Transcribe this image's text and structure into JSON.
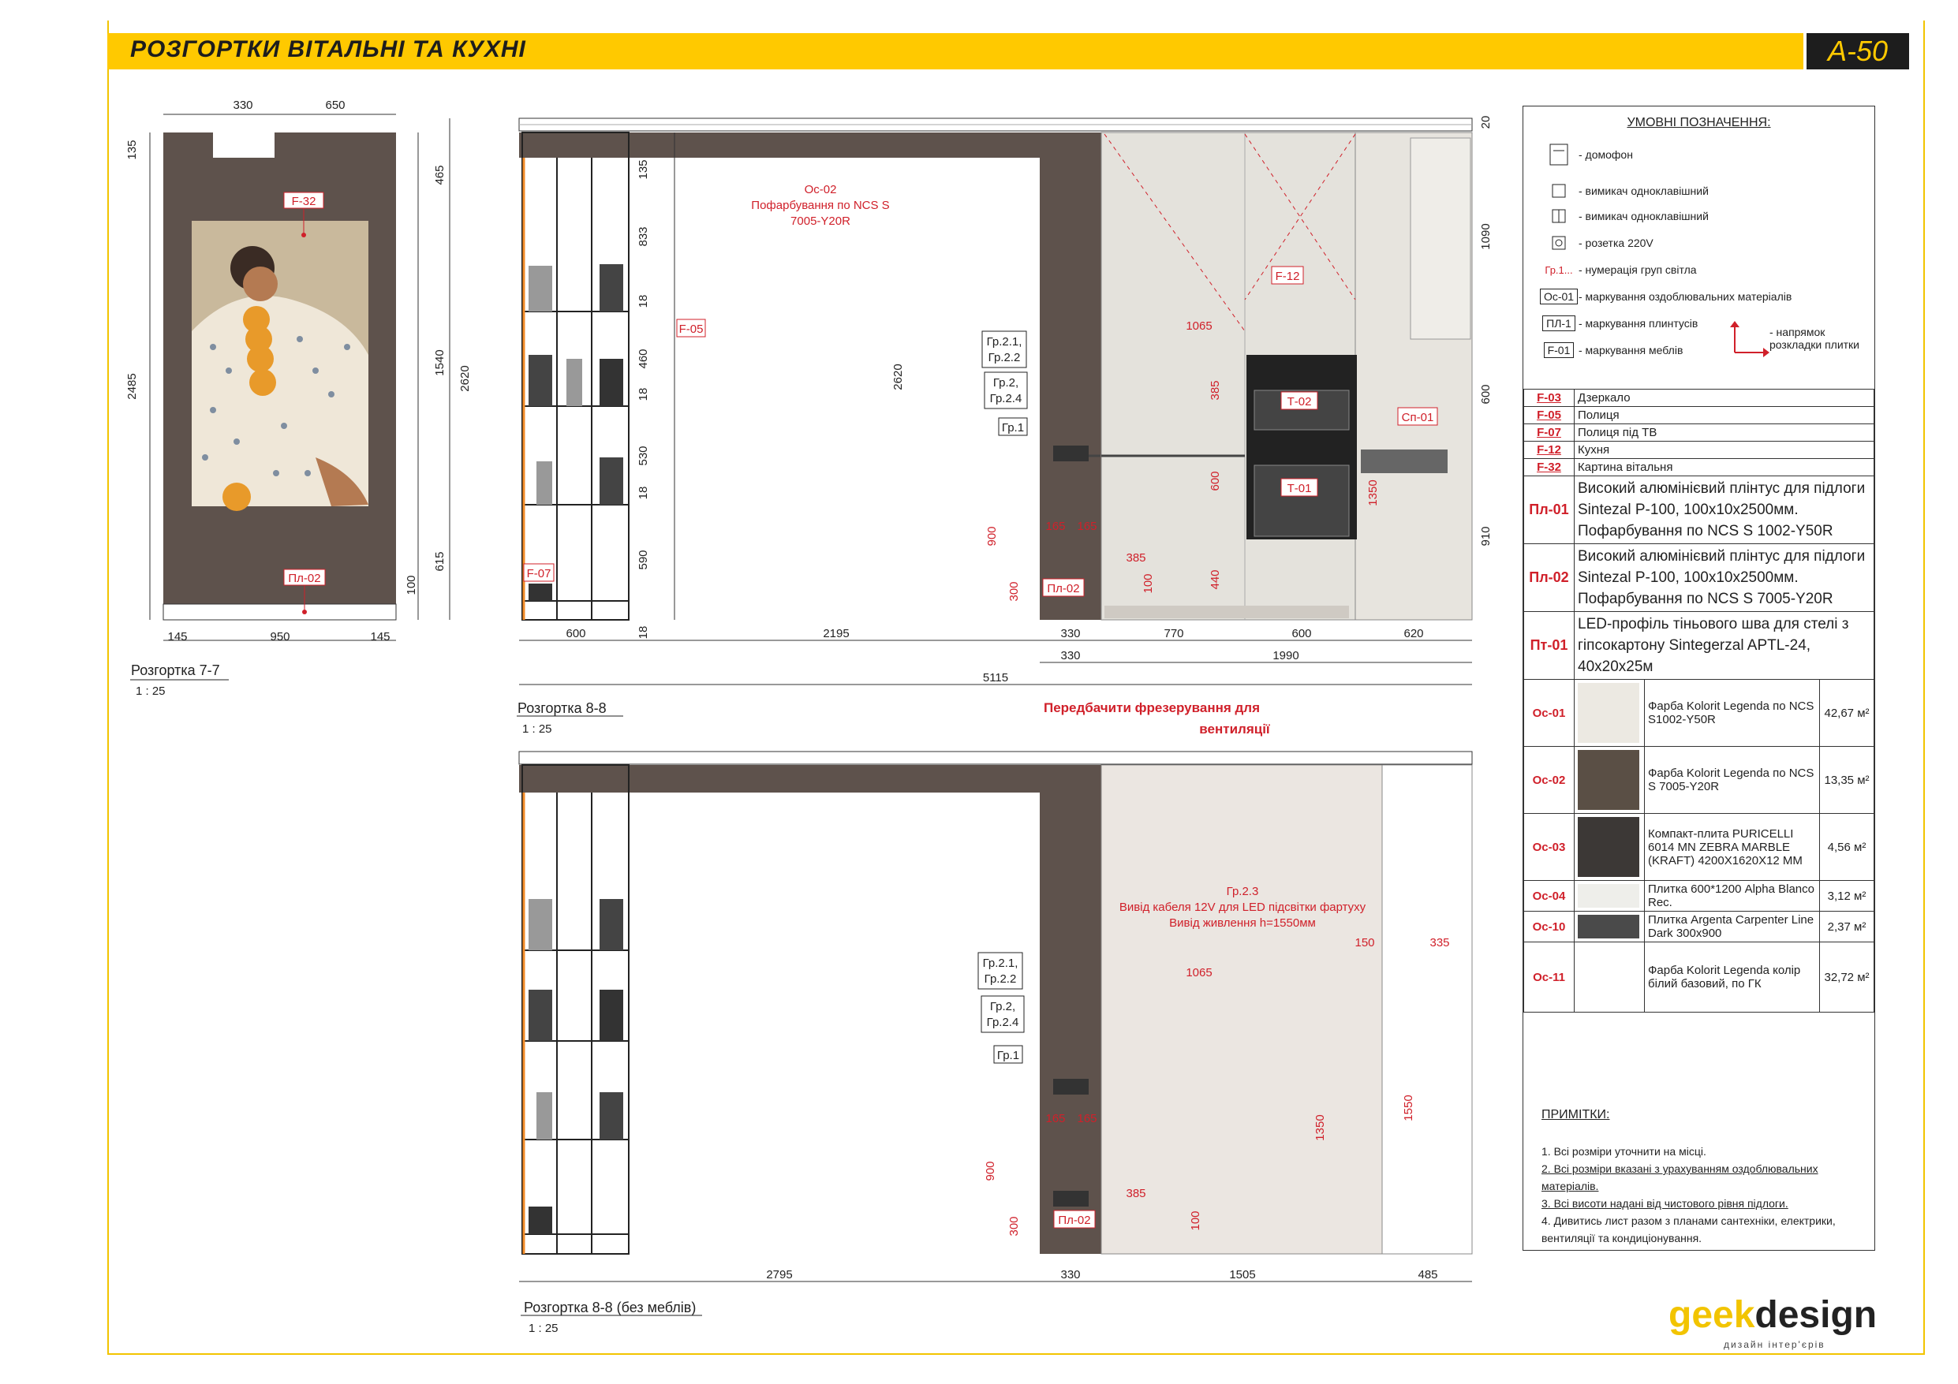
{
  "sheet": {
    "title": "РОЗГОРТКИ ВІТАЛЬНІ ТА КУХНІ",
    "number": "А-50"
  },
  "views": {
    "v77": {
      "title": "Розгортка 7-7",
      "scale": "1 : 25"
    },
    "v88": {
      "title": "Розгортка 8-8",
      "scale": "1 : 25"
    },
    "v88b": {
      "title": "Розгортка 8-8 (без меблів)",
      "scale": "1 : 25"
    }
  },
  "dims77": {
    "top": [
      "330",
      "650"
    ],
    "left": [
      "135",
      "2485"
    ],
    "right": [
      "465",
      "1540",
      "2620",
      "615",
      "100"
    ],
    "bottom": [
      "145",
      "950",
      "145"
    ]
  },
  "dims88": {
    "shelf": [
      "135",
      "833",
      "18",
      "460",
      "18",
      "530",
      "18",
      "590",
      "18"
    ],
    "height_total": "2620",
    "right": [
      "20",
      "1090",
      "600",
      "910"
    ],
    "bottom1": [
      "600",
      "2195",
      "330",
      "770",
      "600",
      "620"
    ],
    "bottom2": [
      "330",
      "1990"
    ],
    "bottom3": "5115",
    "inner": [
      "1065",
      "385",
      "600",
      "440",
      "100",
      "385",
      "165",
      "165",
      "900",
      "300",
      "1350"
    ]
  },
  "dims88b": {
    "bottom": [
      "2795",
      "330",
      "1505",
      "485"
    ],
    "inner": [
      "1065",
      "150",
      "335",
      "385",
      "100",
      "165",
      "165",
      "900",
      "300",
      "1350",
      "1550"
    ]
  },
  "tags88": {
    "os02": "Ос-02",
    "os02_note": [
      "Пофарбування по NCS S",
      "7005-Y20R"
    ],
    "f05": "F-05",
    "f07": "F-07",
    "f12": "F-12",
    "t02": "Т-02",
    "t01": "Т-01",
    "sp01": "Сп-01",
    "pl02": "Пл-02",
    "gr21": [
      "Гр.2.1,",
      "Гр.2.2"
    ],
    "gr2": [
      "Гр.2,",
      "Гр.2.4"
    ],
    "gr1": "Гр.1",
    "vent_note": [
      "Передбачити фрезерування для",
      "вентиляції"
    ]
  },
  "tags77": {
    "f32": "F-32",
    "pl02": "Пл-02"
  },
  "tags88b": {
    "gr23": [
      "Гр.2.3",
      "Вивід кабеля 12V для LED підсвітки фартуху",
      "Вивід живлення h=1550мм"
    ],
    "gr21": [
      "Гр.2.1,",
      "Гр.2.2"
    ],
    "gr2": [
      "Гр.2,",
      "Гр.2.4"
    ],
    "gr1": "Гр.1",
    "pl02": "Пл-02"
  },
  "legend": {
    "header": "УМОВНІ ПОЗНАЧЕННЯ:",
    "symbols": [
      {
        "icon": "intercom-icon",
        "text": "- домофон"
      },
      {
        "icon": "switch-single-icon",
        "text": "- вимикач одноклавішний"
      },
      {
        "icon": "switch-single-alt-icon",
        "text": "- вимикач одноклавішний"
      },
      {
        "icon": "socket-icon",
        "text": "- розетка 220V"
      },
      {
        "icon": "light-group-icon",
        "code": "Гр.1...",
        "text": "- нумерація груп світла"
      },
      {
        "icon": "material-icon",
        "code": "Ос-01",
        "text": "- маркування оздоблювальних матеріалів"
      },
      {
        "icon": "plinth-icon",
        "code": "ПЛ-1",
        "text": "- маркування плинтусів"
      },
      {
        "icon": "furniture-icon",
        "code": "F-01",
        "text": "- маркування меблів"
      }
    ],
    "tile_dir": [
      "- напрямок",
      "розкладки плитки"
    ],
    "furniture": [
      {
        "code": "F-03",
        "text": "Дзеркало"
      },
      {
        "code": "F-05",
        "text": "Полиця"
      },
      {
        "code": "F-07",
        "text": "Полиця під ТВ"
      },
      {
        "code": "F-12",
        "text": "Кухня"
      },
      {
        "code": "F-32",
        "text": "Картина вітальня"
      }
    ],
    "plinths": [
      {
        "code": "Пл-01",
        "text": "Високий алюмінієвий плінтус для підлоги Sintezal P-100, 100x10x2500мм. Пофарбування по NCS S 1002-Y50R"
      },
      {
        "code": "Пл-02",
        "text": "Високий алюмінієвий плінтус для підлоги Sintezal P-100, 100x10x2500мм. Пофарбування по NCS S 7005-Y20R"
      },
      {
        "code": "Пт-01",
        "text": "LED-профіль тіньового шва для стелі з гіпсокартону Sintegerzal APTL-24, 40x20x25м"
      }
    ],
    "materials": [
      {
        "code": "Ос-01",
        "color": "#ece9e2",
        "text": "Фарба Kolorit Legenda по NCS S1002-Y50R",
        "area": "42,67 м²"
      },
      {
        "code": "Ос-02",
        "color": "#5a4f45",
        "text": "Фарба Kolorit Legenda по NCS S 7005-Y20R",
        "area": "13,35 м²"
      },
      {
        "code": "Ос-03",
        "color": "#3c3836",
        "text": "Компакт-плита PURICELLI 6014 MN ZEBRA MARBLE (KRAFT) 4200X1620X12 MM",
        "area": "4,56 м²"
      },
      {
        "code": "Ос-04",
        "color": "#eeeeea",
        "text": "Плитка 600*1200 Alpha Blanco Rec.",
        "area": "3,12 м²"
      },
      {
        "code": "Ос-10",
        "color": "#4a4a4a",
        "text": "Плитка Argenta Carpenter Line Dark 300x900",
        "area": "2,37 м²"
      },
      {
        "code": "Ос-11",
        "color": "#ffffff",
        "text": "Фарба Kolorit Legenda колір білий базовий, по ГК",
        "area": "32,72 м²"
      }
    ]
  },
  "notes": {
    "header": "ПРИМІТКИ:",
    "items": [
      "1. Всі розміри уточнити на місці.",
      "2. Всі розміри вказані з урахуванням оздоблювальних матеріалів.",
      "3. Всі висоти надані від чистового рівня підлоги.",
      "4. Дивитись лист разом з планами сантехніки, електрики, вентиляції та кондиціонування."
    ]
  },
  "logo": {
    "part1": "geek",
    "part2": "design",
    "sub": "дизайн інтер'єрів"
  },
  "colors": {
    "accent": "#ffc900",
    "red": "#d0202a",
    "wall_dark": "#5e524c",
    "wall_light": "#ebe6e1",
    "kitchen": "#e4e2dc"
  }
}
